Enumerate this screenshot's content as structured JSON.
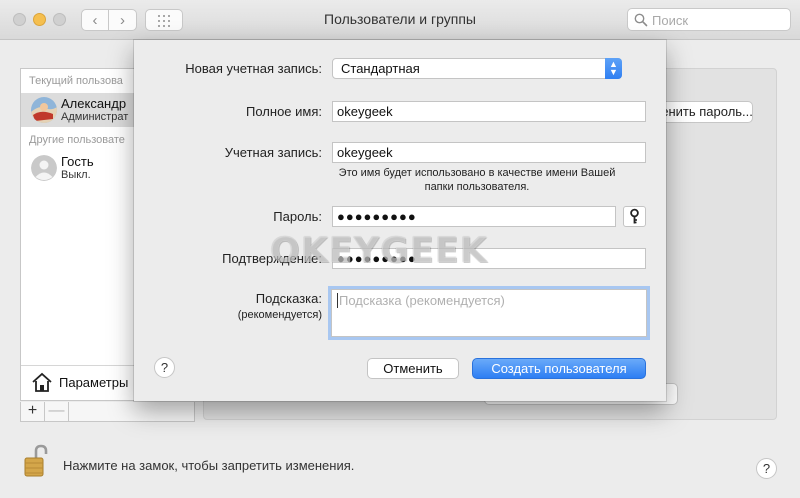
{
  "window": {
    "title": "Пользователи и группы",
    "search_placeholder": "Поиск"
  },
  "users_list": {
    "section_current": "Текущий пользова",
    "current_user": {
      "name": "Александр",
      "role": "Администрат"
    },
    "section_other": "Другие пользовате",
    "other_users": [
      {
        "name": "Гость",
        "status": "Выкл."
      }
    ],
    "params_label": "Параметры",
    "add_label": "+",
    "remove_label": "—"
  },
  "content": {
    "password_button": "Изменить пароль..."
  },
  "sheet": {
    "account_type_label": "Новая учетная запись:",
    "account_type_value": "Стандартная",
    "full_name_label": "Полное имя:",
    "full_name_value": "okeygeek",
    "account_name_label": "Учетная запись:",
    "account_name_value": "okeygeek",
    "account_name_hint": "Это имя будет использовано в качестве имени Вашей папки пользователя.",
    "password_label": "Пароль:",
    "password_value": "●●●●●●●●●",
    "verify_label": "Подтверждение:",
    "verify_value": "●●●●●●●●●",
    "hint_label": "Подсказка:",
    "hint_label_sub": "(рекомендуется)",
    "hint_placeholder": "Подсказка (рекомендуется)",
    "help_label": "?",
    "cancel_label": "Отменить",
    "create_label": "Создать пользователя"
  },
  "footer": {
    "lock_text": "Нажмите на замок, чтобы запретить изменения.",
    "help_label": "?"
  },
  "watermark": "OKEYGEEK",
  "colors": {
    "accent": "#2f7ff2",
    "focus_ring": "#a8c7f1",
    "window_bg": "#ececec"
  }
}
